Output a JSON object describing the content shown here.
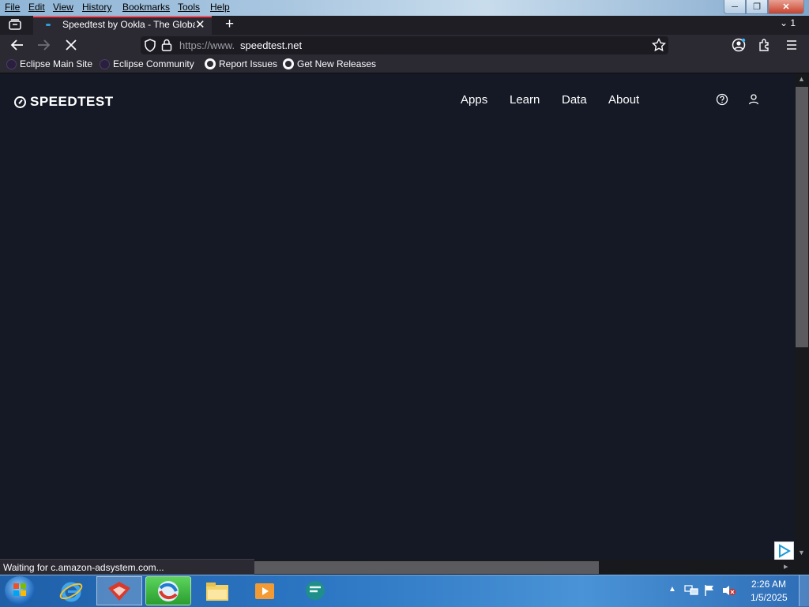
{
  "menu": {
    "file": "File",
    "edit": "Edit",
    "view": "View",
    "history": "History",
    "bookmarks": "Bookmarks",
    "tools": "Tools",
    "help": "Help"
  },
  "tab": {
    "title": "Speedtest by Ookla - The Globa",
    "list_count": "1"
  },
  "url": {
    "prefix": "https://www.",
    "domain": "speedtest.net"
  },
  "bookmarks": [
    {
      "label": "Eclipse Main Site"
    },
    {
      "label": "Eclipse Community"
    },
    {
      "label": "Report Issues"
    },
    {
      "label": "Get New Releases"
    }
  ],
  "site": {
    "logo": "SPEEDTEST",
    "nav": [
      {
        "label": "Apps"
      },
      {
        "label": "Learn"
      },
      {
        "label": "Data"
      },
      {
        "label": "About"
      }
    ]
  },
  "status": "Waiting for c.amazon-adsystem.com...",
  "clock": {
    "time": "2:26 AM",
    "date": "1/5/2025"
  },
  "colors": {
    "page_bg": "#141925",
    "accent": "#ff4f5e"
  }
}
